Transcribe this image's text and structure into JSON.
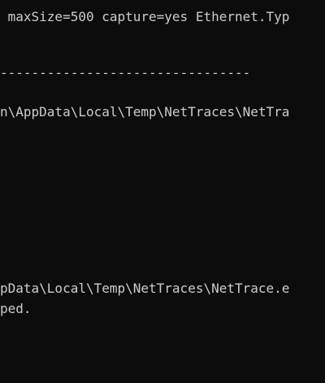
{
  "console": {
    "lines": [
      " maxSize=500 capture=yes Ethernet.Typ",
      "--------------------------------",
      "n\\AppData\\Local\\Temp\\NetTraces\\NetTra",
      "pData\\Local\\Temp\\NetTraces\\NetTrace.e",
      "ped."
    ]
  }
}
